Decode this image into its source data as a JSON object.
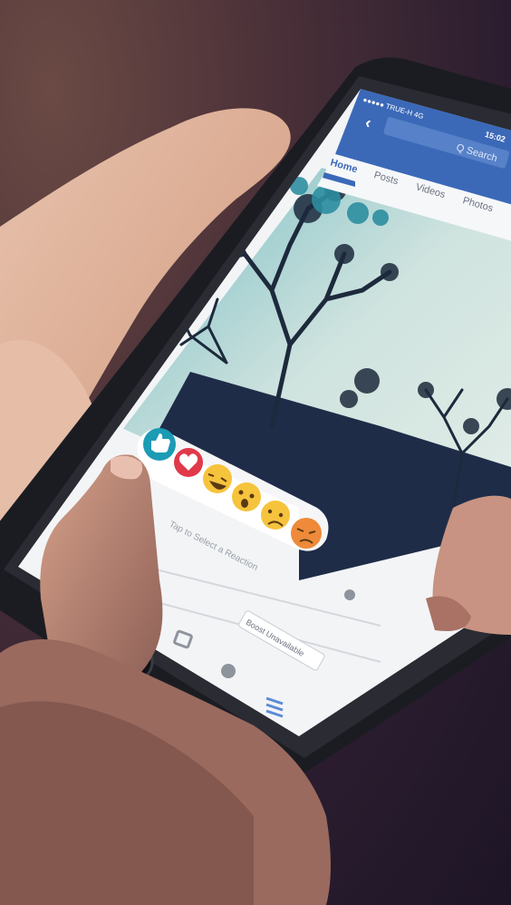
{
  "status_bar": {
    "carrier": "●●●●● TRUE-H  4G",
    "time": "15:02"
  },
  "header": {
    "back_icon": "chevron-left-icon",
    "search_label": "Q Search"
  },
  "tabs": [
    {
      "label": "Home",
      "active": true
    },
    {
      "label": "Posts",
      "active": false
    },
    {
      "label": "Videos",
      "active": false
    },
    {
      "label": "Photos",
      "active": false
    }
  ],
  "reactions": [
    {
      "name": "like",
      "icon": "thumbs-up-icon",
      "color": "#1c9bb4"
    },
    {
      "name": "love",
      "icon": "heart-icon",
      "color": "#e0394a"
    },
    {
      "name": "haha",
      "icon": "laughing-face-icon",
      "color": "#f6c33c"
    },
    {
      "name": "wow",
      "icon": "surprised-face-icon",
      "color": "#f6c33c"
    },
    {
      "name": "sad",
      "icon": "sad-face-icon",
      "color": "#f6c33c"
    },
    {
      "name": "angry",
      "icon": "angry-face-icon",
      "color": "#ee8a3a"
    }
  ],
  "reaction_hint": "Tap to Select a Reaction",
  "boost_button": "Boost Unavailable",
  "colors": {
    "facebook_blue": "#3b69b8",
    "photo_teal": "#2d8ea0",
    "photo_sky": "#dce9e6"
  }
}
